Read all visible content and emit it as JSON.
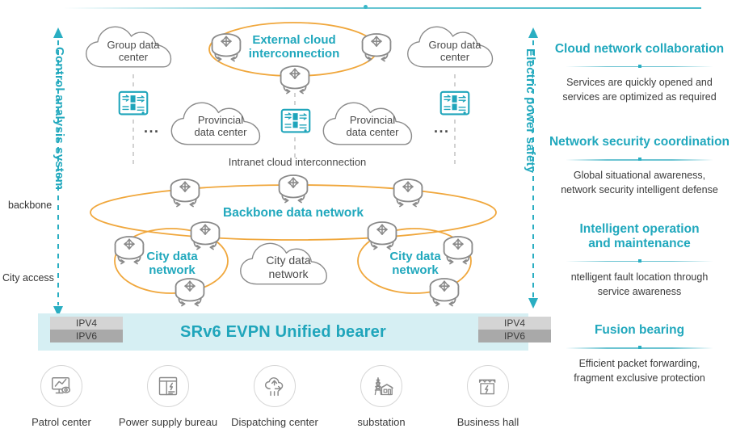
{
  "axes": {
    "left_label": "Control analysis system",
    "right_label": "Electric power safety",
    "left_tick_backbone": "backbone",
    "left_tick_city_access": "City access"
  },
  "diagram": {
    "clouds": {
      "group_data_center_left": "Group data\ncenter",
      "group_data_center_right": "Group data\ncenter",
      "provincial_data_center_left": "Provincial\ndata center",
      "provincial_data_center_right": "Provincial\ndata center",
      "city_data_network_cloud": "City data\nnetwork"
    },
    "ring_labels": {
      "external_cloud": "External cloud\ninterconnection",
      "backbone": "Backbone data network",
      "city_left": "City data\nnetwork",
      "city_right": "City data\nnetwork"
    },
    "captions": {
      "intranet": "Intranet cloud interconnection",
      "ellipsis": "..."
    }
  },
  "bearer": {
    "title": "SRv6 EVPN Unified bearer",
    "left_stack": [
      "IPV4",
      "IPV6"
    ],
    "right_stack": [
      "IPV4",
      "IPV6"
    ]
  },
  "endpoints": [
    {
      "icon": "patrol-monitor-icon",
      "label": "Patrol center"
    },
    {
      "icon": "power-supply-icon",
      "label": "Power supply bureau"
    },
    {
      "icon": "dispatching-icon",
      "label": "Dispatching center"
    },
    {
      "icon": "substation-icon",
      "label": "substation"
    },
    {
      "icon": "business-hall-icon",
      "label": "Business hall"
    }
  ],
  "features": [
    {
      "title": "Cloud network collaboration",
      "desc": "Services are quickly opened and\nservices are optimized as required"
    },
    {
      "title": "Network security coordination",
      "desc": "Global situational awareness,\nnetwork security intelligent defense"
    },
    {
      "title": "Intelligent operation\nand maintenance",
      "desc": "ntelligent fault location through\nservice awareness"
    },
    {
      "title": "Fusion bearing",
      "desc": "Efficient packet forwarding,\nfragment exclusive protection"
    }
  ],
  "colors": {
    "accent_teal": "#21a8bd",
    "orange_ring": "#f0a73c",
    "gray_outline": "#8a8a8a",
    "band_bg": "#d6eff3",
    "ipv4_bar": "#d4d4d4",
    "ipv6_bar": "#a9a9a9"
  }
}
